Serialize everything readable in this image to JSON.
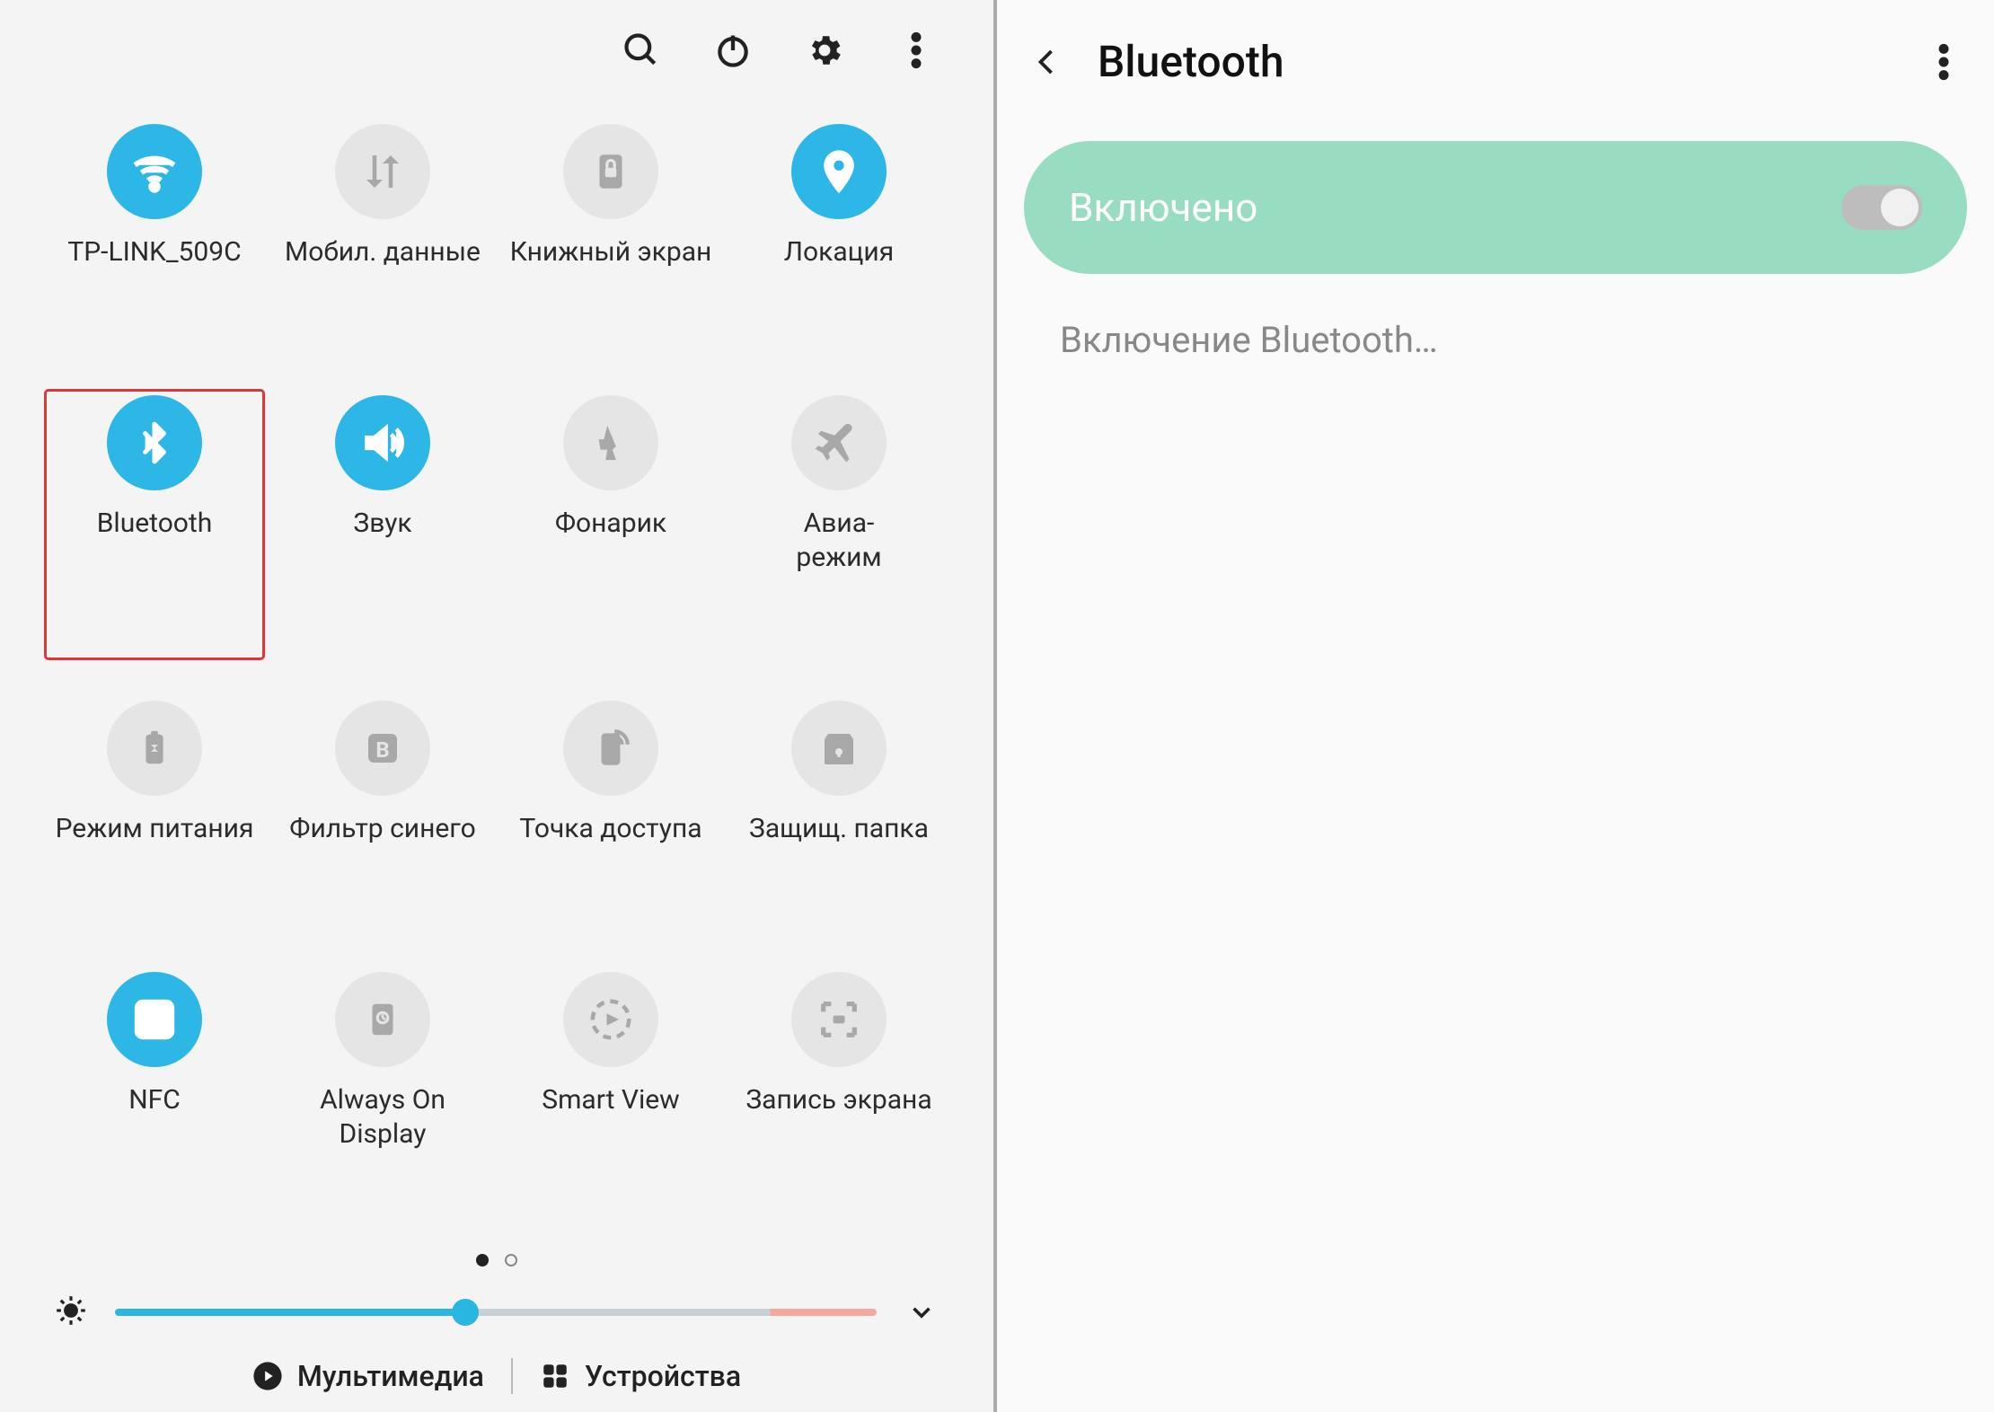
{
  "quick_settings": {
    "header_icons": [
      "search",
      "power",
      "settings",
      "more"
    ],
    "tiles": [
      {
        "id": "wifi",
        "label": "TP-LINK_509C",
        "on": true,
        "icon": "wifi",
        "highlight": false
      },
      {
        "id": "mobiledata",
        "label": "Мобил. данные",
        "on": false,
        "icon": "data",
        "highlight": false
      },
      {
        "id": "booklike",
        "label": "Книжный экран",
        "on": false,
        "icon": "lock-book",
        "highlight": false
      },
      {
        "id": "location",
        "label": "Локация",
        "on": true,
        "icon": "location",
        "highlight": false
      },
      {
        "id": "bluetooth",
        "label": "Bluetooth",
        "on": true,
        "icon": "bluetooth",
        "highlight": true
      },
      {
        "id": "sound",
        "label": "Звук",
        "on": true,
        "icon": "sound",
        "highlight": false
      },
      {
        "id": "flashlight",
        "label": "Фонарик",
        "on": false,
        "icon": "flash",
        "highlight": false
      },
      {
        "id": "airplane",
        "label": "Авиа-\nрежим",
        "on": false,
        "icon": "airplane",
        "highlight": false
      },
      {
        "id": "battery",
        "label": "Режим питания",
        "on": false,
        "icon": "battery",
        "highlight": false
      },
      {
        "id": "bluefilter",
        "label": "Фильтр синего",
        "on": false,
        "icon": "bluelight",
        "highlight": false
      },
      {
        "id": "hotspot",
        "label": "Точка доступа",
        "on": false,
        "icon": "hotspot",
        "highlight": false
      },
      {
        "id": "secure",
        "label": "Защищ. папка",
        "on": false,
        "icon": "secure",
        "highlight": false
      },
      {
        "id": "nfc",
        "label": "NFC",
        "on": true,
        "icon": "nfc",
        "highlight": false
      },
      {
        "id": "aod",
        "label": "Always On Display",
        "on": false,
        "icon": "aod",
        "highlight": false
      },
      {
        "id": "smartview",
        "label": "Smart View",
        "on": false,
        "icon": "smartview",
        "highlight": false
      },
      {
        "id": "screenrec",
        "label": "Запись экрана",
        "on": false,
        "icon": "record",
        "highlight": false
      }
    ],
    "page": {
      "current": 0,
      "total": 2
    },
    "brightness_percent": 46,
    "bottom": {
      "media": "Мультимедиа",
      "devices": "Устройства"
    }
  },
  "bluetooth_page": {
    "title": "Bluetooth",
    "status_label": "Включено",
    "toggle_on": true,
    "sub_status": "Включение Bluetooth…"
  }
}
